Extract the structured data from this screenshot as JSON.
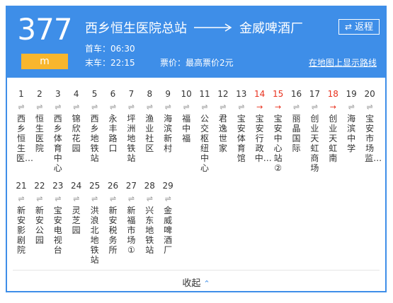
{
  "route": {
    "number": "377",
    "tag": "m",
    "from": "西乡恒生医院总站",
    "to": "金威啤酒厂",
    "return_label": "返程",
    "first_bus": "首车：06:30",
    "last_bus": "末车：22:15",
    "fare": "票价：最高票价2元",
    "map_link": "在地图上显示路线"
  },
  "stops": [
    {
      "num": "1",
      "name": "西乡恒生医…"
    },
    {
      "num": "2",
      "name": "恒生医院"
    },
    {
      "num": "3",
      "name": "西乡体育中心"
    },
    {
      "num": "4",
      "name": "锦欣花园"
    },
    {
      "num": "5",
      "name": "西乡地铁站"
    },
    {
      "num": "6",
      "name": "永丰路口"
    },
    {
      "num": "7",
      "name": "坪洲地铁站"
    },
    {
      "num": "8",
      "name": "渔业社区"
    },
    {
      "num": "9",
      "name": "海滨新村"
    },
    {
      "num": "10",
      "name": "福中福"
    },
    {
      "num": "11",
      "name": "公交枢纽中心"
    },
    {
      "num": "12",
      "name": "君逸世家"
    },
    {
      "num": "13",
      "name": "宝安体育馆"
    },
    {
      "num": "14",
      "name": "宝安行政中…",
      "highlight": true
    },
    {
      "num": "15",
      "name": "宝安中心站②",
      "highlight": true
    },
    {
      "num": "16",
      "name": "丽晶国际"
    },
    {
      "num": "17",
      "name": "创业天虹商场"
    },
    {
      "num": "18",
      "name": "创业天虹南",
      "highlight": true
    },
    {
      "num": "19",
      "name": "海滨中学"
    },
    {
      "num": "20",
      "name": "宝安市场监…"
    },
    {
      "num": "21",
      "name": "新安影剧院"
    },
    {
      "num": "22",
      "name": "新安公园"
    },
    {
      "num": "23",
      "name": "宝安电视台"
    },
    {
      "num": "24",
      "name": "灵芝园"
    },
    {
      "num": "25",
      "name": "洪浪北地铁站"
    },
    {
      "num": "26",
      "name": "新安税务所"
    },
    {
      "num": "27",
      "name": "新福市场①"
    },
    {
      "num": "28",
      "name": "兴东地铁站"
    },
    {
      "num": "29",
      "name": "金威啤酒厂"
    }
  ],
  "icons": {
    "direction_normal": "⇌",
    "direction_single": "→",
    "return": "⇄",
    "collapse": "⌃"
  },
  "footer": {
    "collapse_label": "收起"
  },
  "colors": {
    "header_bg": "#3e8ee8",
    "tag_bg": "#f8b62d",
    "highlight": "#e8301c"
  }
}
